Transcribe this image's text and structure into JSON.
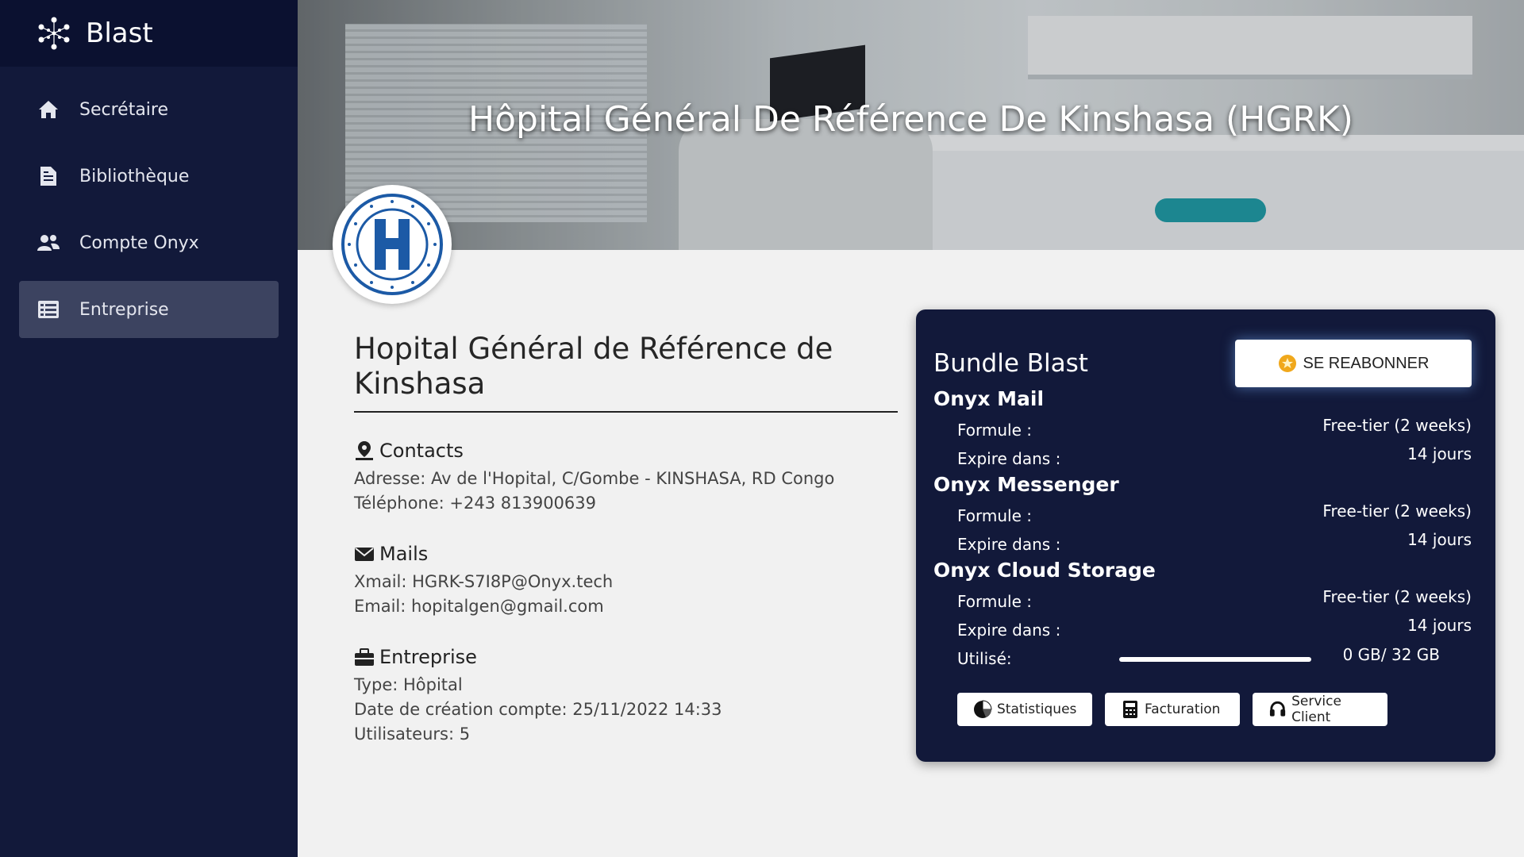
{
  "app": {
    "name": "Blast"
  },
  "sidebar": {
    "items": [
      {
        "label": "Secrétaire",
        "icon": "home-icon"
      },
      {
        "label": "Bibliothèque",
        "icon": "document-icon"
      },
      {
        "label": "Compte Onyx",
        "icon": "users-icon"
      },
      {
        "label": "Entreprise",
        "icon": "list-icon",
        "active": true
      }
    ]
  },
  "banner": {
    "title": "Hôpital Général De Référence De Kinshasa (HGRK)"
  },
  "company": {
    "name": "Hopital Général de Référence de Kinshasa",
    "contacts": {
      "heading": "Contacts",
      "address": "Adresse: Av de l'Hopital, C/Gombe - KINSHASA, RD Congo",
      "phone": "Téléphone: +243 813900639"
    },
    "mails": {
      "heading": "Mails",
      "xmail": "Xmail: HGRK-S7I8P@Onyx.tech",
      "email": "Email: hopitalgen@gmail.com"
    },
    "enterprise": {
      "heading": "Entreprise",
      "type": "Type: Hôpital",
      "created": "Date de création compte: 25/11/2022 14:33",
      "users": "Utilisateurs: 5"
    }
  },
  "bundle": {
    "title": "Bundle Blast",
    "resubscribe_label": "SE REABONNER",
    "products": [
      {
        "name": "Onyx Mail",
        "formule_label": "Formule :",
        "formule": "Free-tier (2 weeks)",
        "expire_label": "Expire dans :",
        "expire": "14 jours"
      },
      {
        "name": "Onyx Messenger",
        "formule_label": "Formule :",
        "formule": "Free-tier (2 weeks)",
        "expire_label": "Expire dans :",
        "expire": "14 jours"
      },
      {
        "name": "Onyx Cloud Storage",
        "formule_label": "Formule :",
        "formule": "Free-tier (2 weeks)",
        "expire_label": "Expire dans :",
        "expire": "14 jours",
        "used_label": "Utilisé:",
        "used": "0 GB/ 32 GB",
        "used_fraction": 0
      }
    ],
    "buttons": {
      "stats": "Statistiques",
      "billing": "Facturation",
      "support": "Service Client"
    }
  },
  "colors": {
    "sidebar": "#12193a",
    "brand_bar": "#0b1130",
    "active_item": "#3c4360",
    "card": "#12193a",
    "page": "#f1f1f1"
  }
}
